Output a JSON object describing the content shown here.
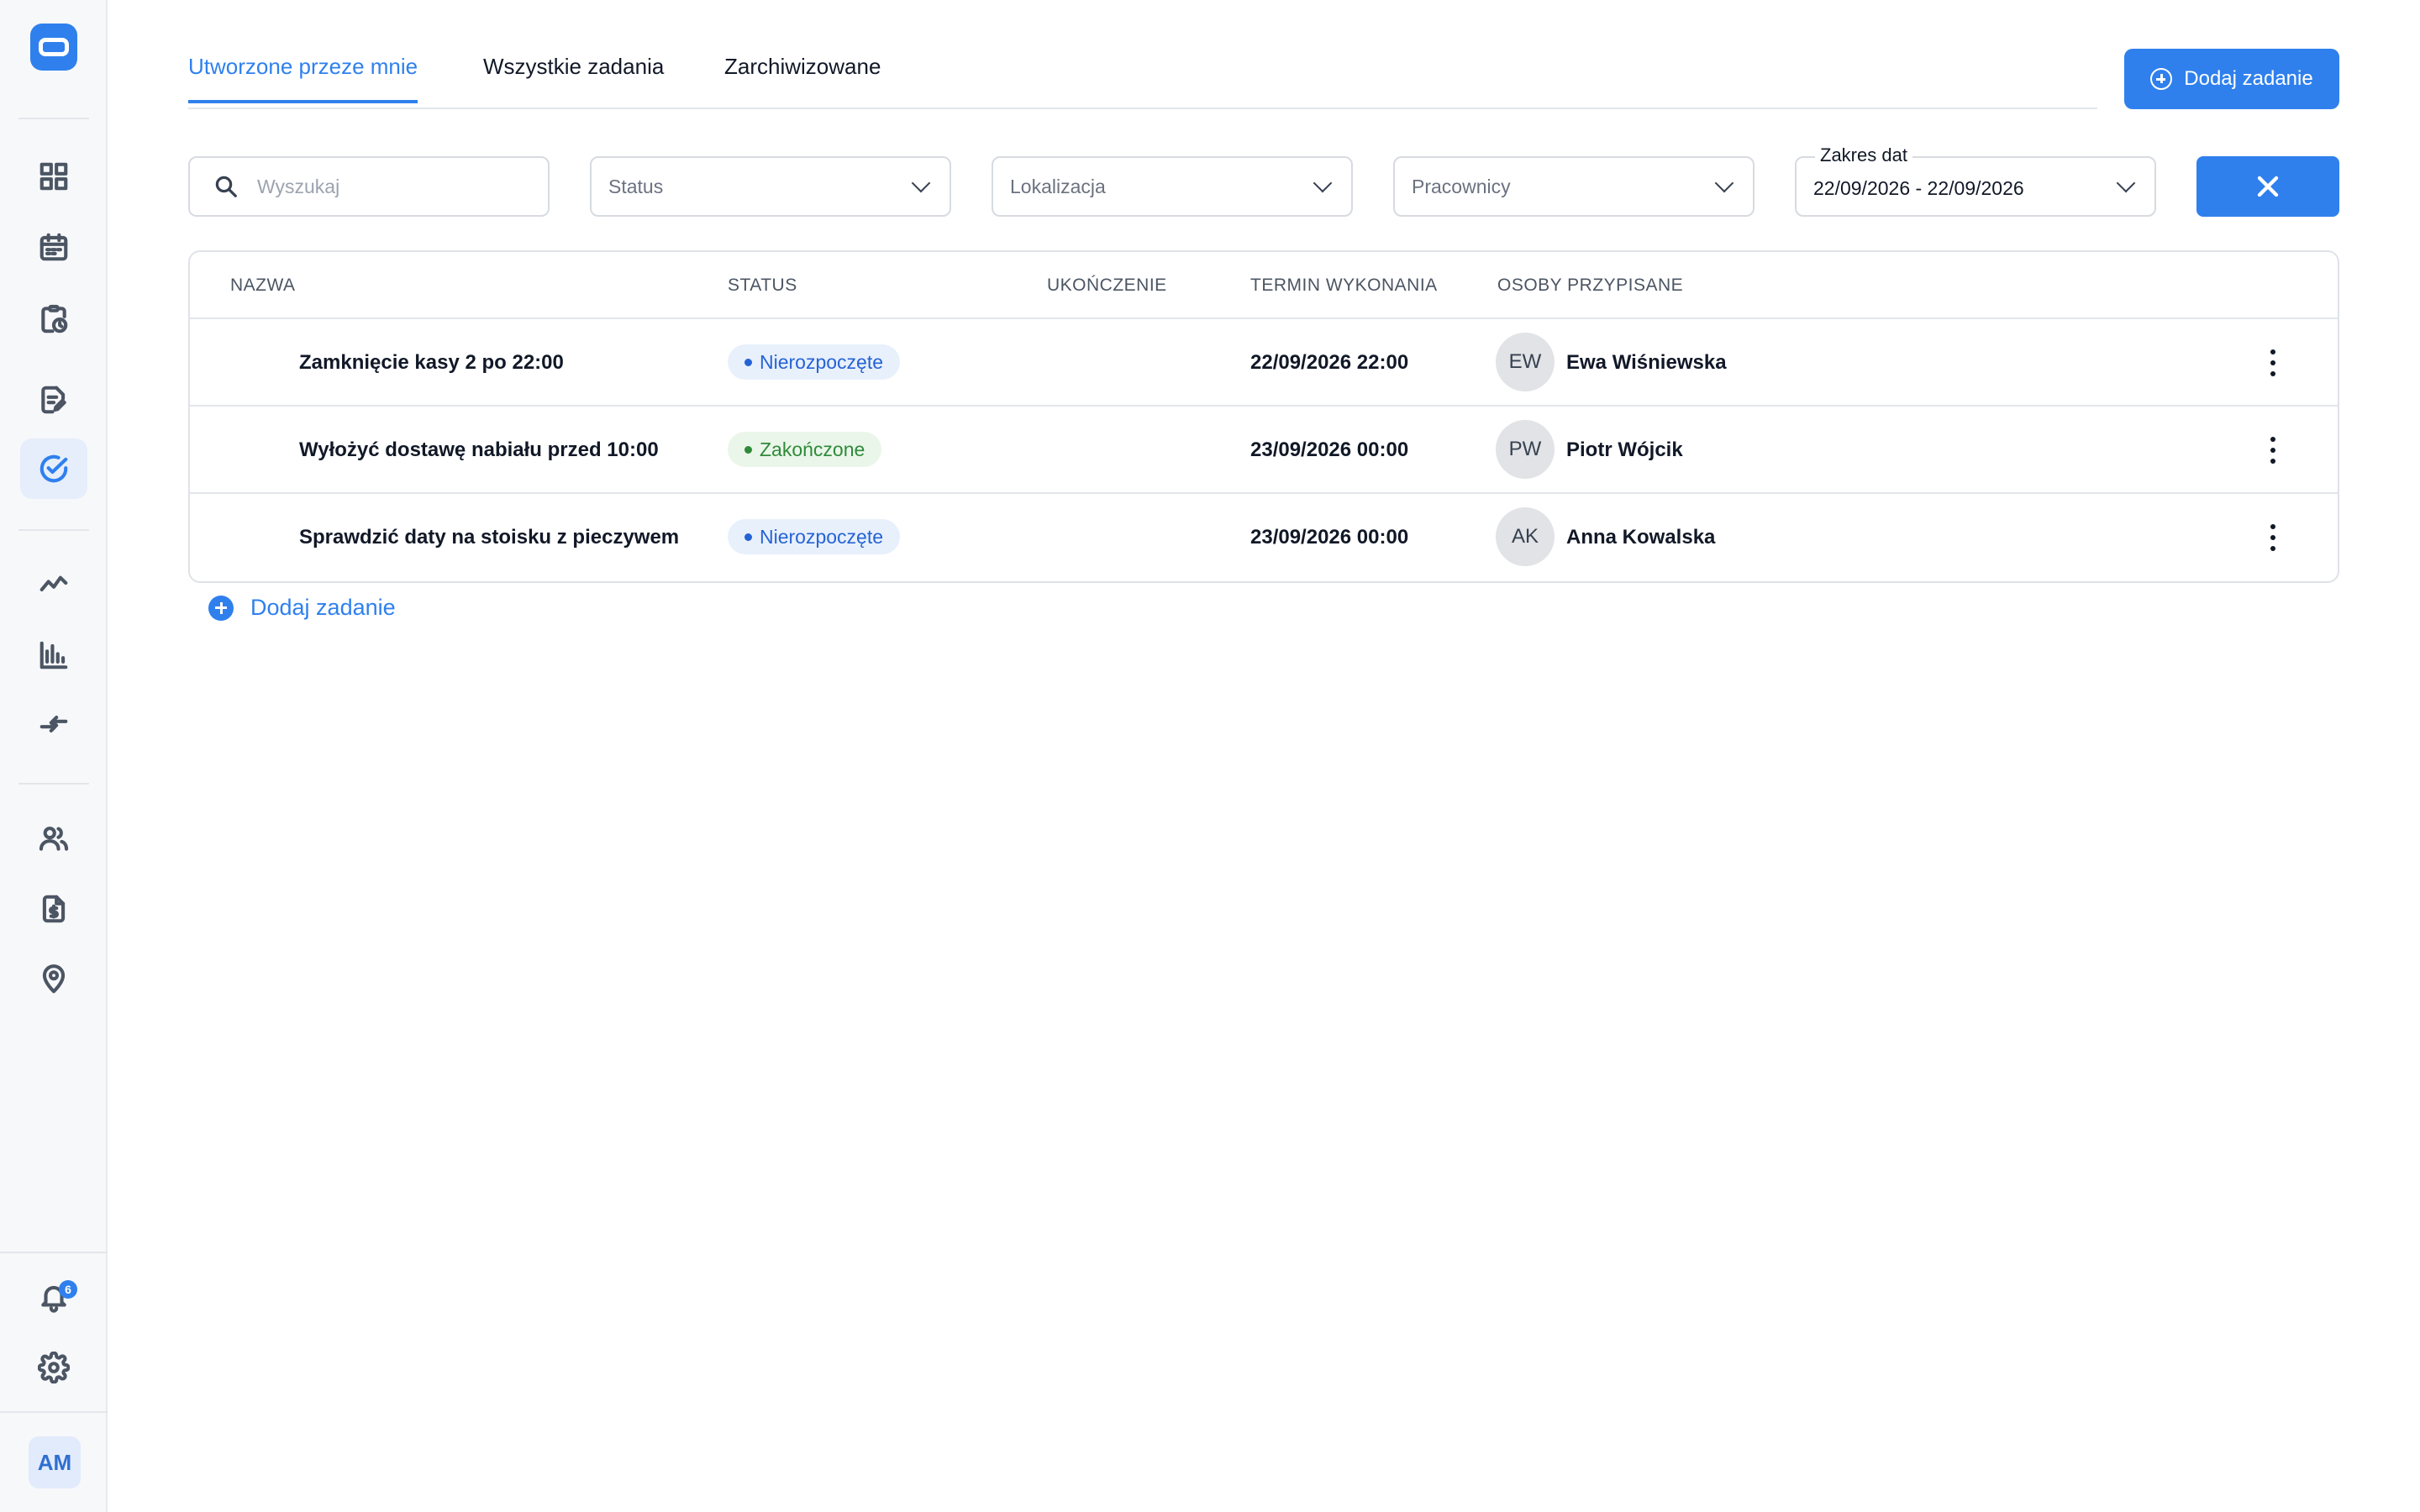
{
  "sidebar": {
    "nav_top": [
      {
        "icon": "dashboard-icon"
      },
      {
        "icon": "calendar-icon"
      },
      {
        "icon": "clipboard-clock-icon"
      },
      {
        "icon": "document-edit-icon"
      },
      {
        "icon": "tasks-check-icon",
        "active": true
      }
    ],
    "nav_mid": [
      {
        "icon": "trend-line-icon"
      },
      {
        "icon": "bar-chart-icon"
      },
      {
        "icon": "transfer-arrows-icon"
      }
    ],
    "nav_bottom": [
      {
        "icon": "users-icon"
      },
      {
        "icon": "payment-document-icon"
      },
      {
        "icon": "location-pin-icon"
      }
    ],
    "notifications_count": "6",
    "user_initials": "AM"
  },
  "tabs": [
    {
      "label": "Utworzone przeze mnie",
      "active": true
    },
    {
      "label": "Wszystkie zadania",
      "active": false
    },
    {
      "label": "Zarchiwizowane",
      "active": false
    }
  ],
  "add_task_button": "Dodaj zadanie",
  "filters": {
    "search_placeholder": "Wyszukaj",
    "status": "Status",
    "location": "Lokalizacja",
    "employees": "Pracownicy",
    "date_range_label": "Zakres dat",
    "date_range_value": "22/09/2026 - 22/09/2026"
  },
  "table": {
    "columns": [
      "NAZWA",
      "STATUS",
      "UKOŃCZENIE",
      "TERMIN WYKONANIA",
      "OSOBY PRZYPISANE"
    ],
    "rows": [
      {
        "name": "Zamknięcie kasy 2 po 22:00",
        "status": "Nierozpoczęte",
        "status_type": "not-started",
        "completion": "",
        "due": "22/09/2026 22:00",
        "initials": "EW",
        "person": "Ewa Wiśniewska"
      },
      {
        "name": "Wyłożyć dostawę nabiału przed 10:00",
        "status": "Zakończone",
        "status_type": "done",
        "completion": "",
        "due": "23/09/2026 00:00",
        "initials": "PW",
        "person": "Piotr Wójcik"
      },
      {
        "name": "Sprawdzić daty na stoisku z pieczywem",
        "status": "Nierozpoczęte",
        "status_type": "not-started",
        "completion": "",
        "due": "23/09/2026 00:00",
        "initials": "AK",
        "person": "Anna Kowalska"
      }
    ]
  },
  "add_task_link": "Dodaj zadanie",
  "colors": {
    "accent": "#2f80ed",
    "status_not_started_bg": "#e8f0fc",
    "status_not_started_fg": "#2563d4",
    "status_done_bg": "#eaf6e9",
    "status_done_fg": "#2f8a3a"
  }
}
